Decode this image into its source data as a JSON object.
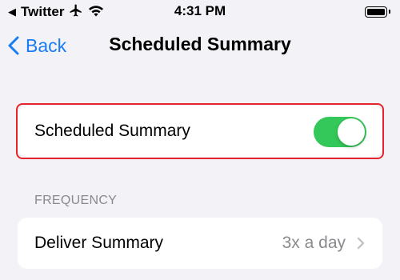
{
  "status_bar": {
    "back_indicator": "◀",
    "carrier": "Twitter",
    "airplane_icon": "airplane-icon",
    "wifi_icon": "wifi-icon",
    "time": "4:31 PM",
    "battery_icon": "battery-icon"
  },
  "nav": {
    "back_label": "Back",
    "title": "Scheduled Summary"
  },
  "toggle_row": {
    "label": "Scheduled Summary",
    "enabled": true,
    "toggle_color": "#34c759",
    "highlight_color": "#e8222e"
  },
  "frequency_section": {
    "header": "FREQUENCY",
    "row": {
      "label": "Deliver Summary",
      "value": "3x a day"
    }
  },
  "colors": {
    "accent": "#1a7cf5",
    "background": "#f2f2f7",
    "secondary_text": "#8a8a8e"
  }
}
